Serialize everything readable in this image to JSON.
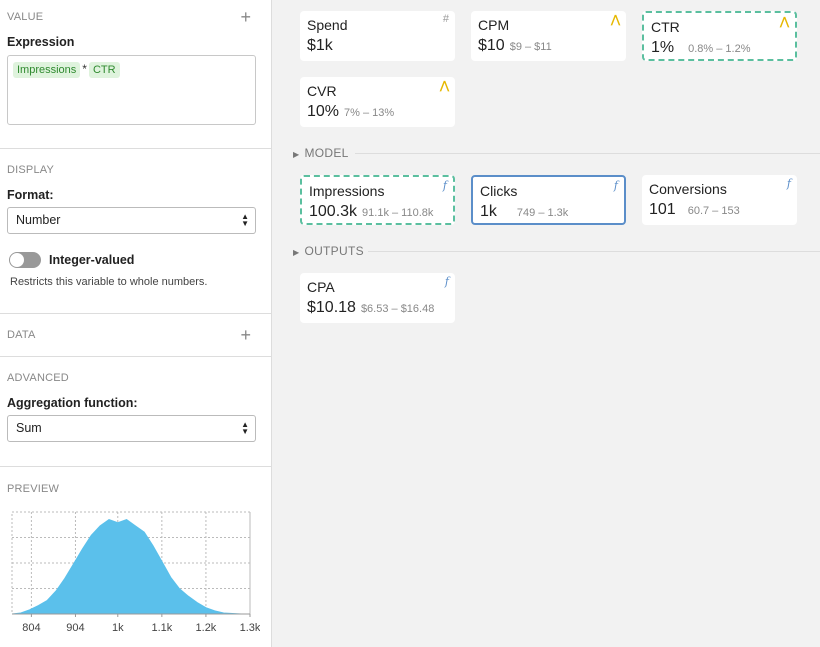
{
  "sidebar": {
    "value_section": {
      "title": "VALUE",
      "expression_label": "Expression",
      "expression_tokens": [
        "Impressions",
        "*",
        "CTR"
      ]
    },
    "display_section": {
      "title": "DISPLAY",
      "format_label": "Format:",
      "format_value": "Number",
      "integer_label": "Integer-valued",
      "integer_on": false,
      "integer_hint": "Restricts this variable to whole numbers."
    },
    "data_section": {
      "title": "DATA"
    },
    "advanced_section": {
      "title": "ADVANCED",
      "aggregation_label": "Aggregation function:",
      "aggregation_value": "Sum"
    },
    "preview_section": {
      "title": "PREVIEW"
    }
  },
  "chart_data": {
    "type": "area",
    "x": [
      760,
      780,
      800,
      820,
      840,
      860,
      880,
      900,
      920,
      940,
      960,
      980,
      1000,
      1020,
      1040,
      1060,
      1080,
      1100,
      1120,
      1140,
      1160,
      1180,
      1200,
      1220,
      1240,
      1260,
      1280,
      1300
    ],
    "y": [
      0,
      1,
      4,
      8,
      13,
      22,
      34,
      48,
      62,
      75,
      84,
      90,
      87,
      90,
      84,
      78,
      65,
      50,
      35,
      24,
      17,
      11,
      6,
      3,
      1,
      0.5,
      0,
      0
    ],
    "xticks": [
      804,
      904,
      1000,
      1100,
      1200,
      1300
    ],
    "xtick_labels": [
      "804",
      "904",
      "1k",
      "1.1k",
      "1.2k",
      "1.3k"
    ],
    "xlim": [
      760,
      1300
    ],
    "grid": true,
    "color": "#5bc0eb"
  },
  "groups": {
    "model_label": "MODEL",
    "outputs_label": "OUTPUTS"
  },
  "cards": {
    "spend": {
      "name": "Spend",
      "value": "$1k",
      "range": "",
      "icon": "hash-icon",
      "icon_char": "#"
    },
    "cpm": {
      "name": "CPM",
      "value": "$10",
      "range": "$9 – $11",
      "icon": "distribution-icon",
      "icon_char": "⋀"
    },
    "ctr": {
      "name": "CTR",
      "value": "1%",
      "range": "0.8% – 1.2%",
      "icon": "distribution-icon",
      "icon_char": "⋀"
    },
    "cvr": {
      "name": "CVR",
      "value": "10%",
      "range": "7% – 13%",
      "icon": "distribution-icon",
      "icon_char": "⋀"
    },
    "impressions": {
      "name": "Impressions",
      "value": "100.3k",
      "range": "91.1k – 110.8k",
      "icon": "function-icon",
      "icon_char": "f"
    },
    "clicks": {
      "name": "Clicks",
      "value": "1k",
      "range": "749 – 1.3k",
      "icon": "function-icon",
      "icon_char": "f"
    },
    "conversions": {
      "name": "Conversions",
      "value": "101",
      "range": "60.7 – 153",
      "icon": "function-icon",
      "icon_char": "f"
    },
    "cpa": {
      "name": "CPA",
      "value": "$10.18",
      "range": "$6.53 – $16.48",
      "icon": "function-icon",
      "icon_char": "f"
    }
  },
  "colors": {
    "dashed_border": "#5bbf9f",
    "selected_border": "#5b8ec9",
    "distribution_icon": "#e6b800",
    "function_icon": "#5b8ec9"
  }
}
